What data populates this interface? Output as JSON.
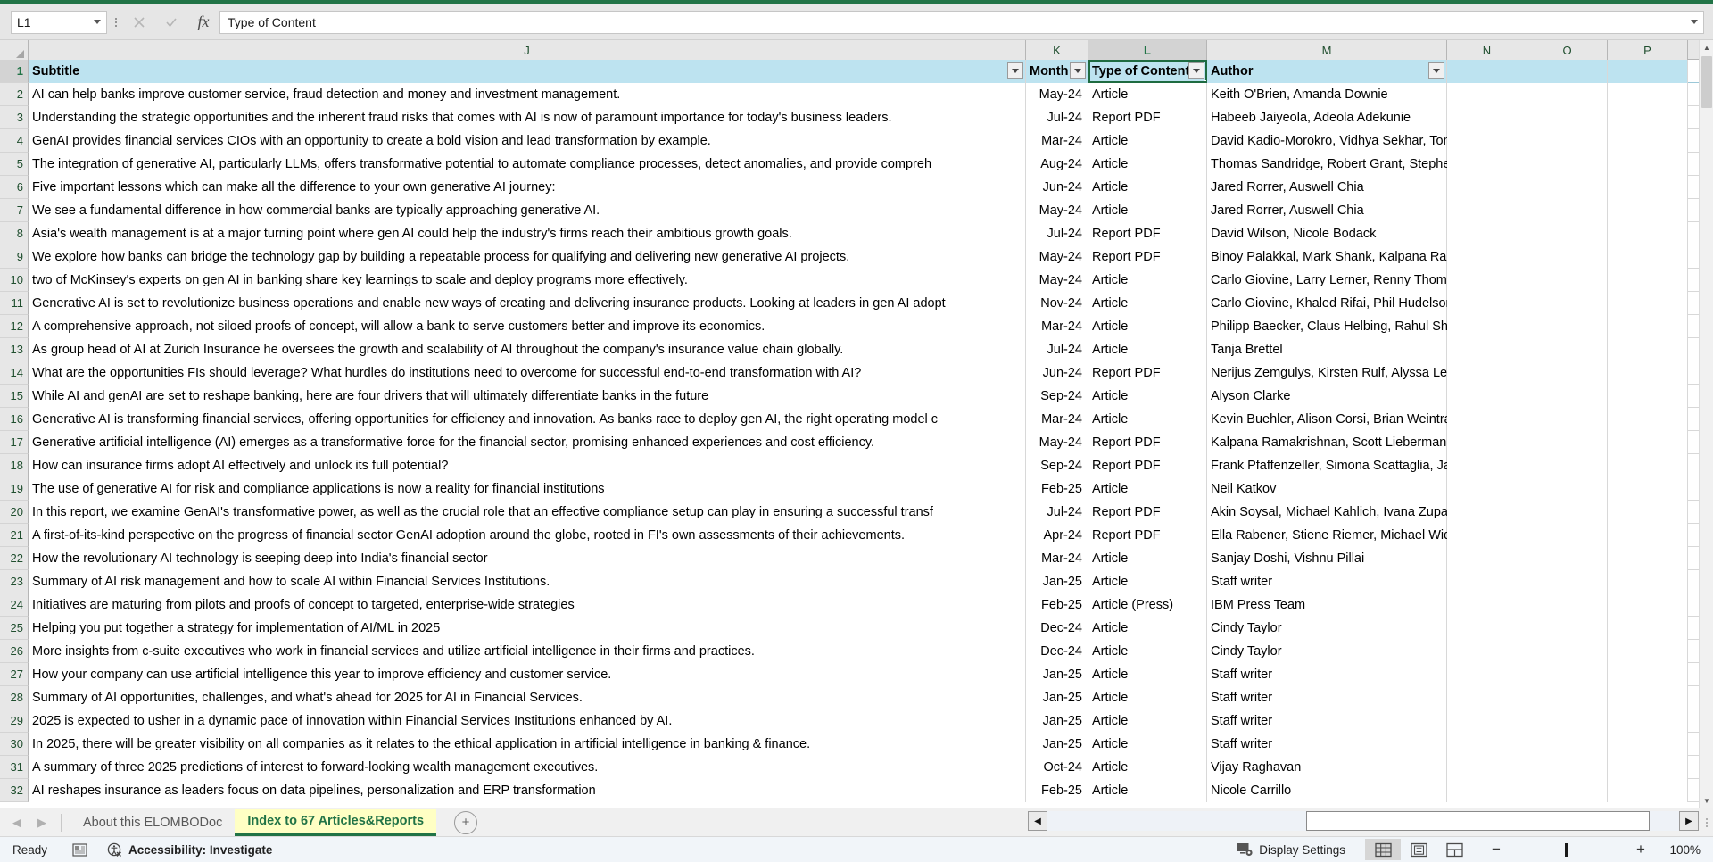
{
  "formula_bar": {
    "name_box_value": "L1",
    "cancel_icon": "close-icon",
    "confirm_icon": "check-icon",
    "function_icon": "fx-icon",
    "formula_value": "Type of Content"
  },
  "grid": {
    "column_headers": [
      "J",
      "K",
      "L",
      "M",
      "N",
      "O",
      "P"
    ],
    "selected_column": "L",
    "selected_cell": "L1",
    "header_row_index": "1",
    "headers": {
      "J": "Subtitle",
      "K": "Month P",
      "L": "Type of Content",
      "M": "Author",
      "N": "",
      "O": "",
      "P": ""
    },
    "rows": [
      {
        "n": "2",
        "subtitle": "AI can help banks improve customer service, fraud detection and money and investment management.",
        "month": "May-24",
        "type": "Article",
        "author": "Keith O'Brien, Amanda Downie"
      },
      {
        "n": "3",
        "subtitle": "Understanding the strategic opportunities and the inherent fraud risks that comes with AI is now of paramount importance for today's business leaders.",
        "month": "Jul-24",
        "type": "Report PDF",
        "author": "Habeeb Jaiyeola, Adeola Adekunie"
      },
      {
        "n": "4",
        "subtitle": "GenAI provides financial services CIOs with an opportunity to create a bold vision and lead transformation by example.",
        "month": "Mar-24",
        "type": "Article",
        "author": "David Kadio-Morokro, Vidhya Sekhar, Tommy Vater, Shobhan Dutta"
      },
      {
        "n": "5",
        "subtitle": "The integration of generative AI, particularly LLMs, offers transformative potential to automate compliance processes, detect anomalies, and provide compreh",
        "month": "Aug-24",
        "type": "Article",
        "author": "Thomas Sandridge, Robert Grant, Stephen Forster, Brandon Harris"
      },
      {
        "n": "6",
        "subtitle": "Five important lessons which can make all the difference to your own generative AI journey:",
        "month": "Jun-24",
        "type": "Article",
        "author": "Jared Rorrer, Auswell Chia"
      },
      {
        "n": "7",
        "subtitle": "We see a fundamental difference in how commercial banks are typically approaching generative AI.",
        "month": "May-24",
        "type": "Article",
        "author": "Jared Rorrer, Auswell Chia"
      },
      {
        "n": "8",
        "subtitle": "Asia's wealth management is at a major turning point where gen AI could help the industry's firms reach their ambitious growth goals.",
        "month": "Jul-24",
        "type": "Report PDF",
        "author": "David Wilson, Nicole Bodack"
      },
      {
        "n": "9",
        "subtitle": "We explore how banks can bridge the technology gap by building a repeatable process for qualifying and delivering new generative AI projects.",
        "month": "May-24",
        "type": "Report PDF",
        "author": "Binoy Palakkal, Mark Shank, Kalpana Ramakrishnan"
      },
      {
        "n": "10",
        "subtitle": "two of McKinsey's experts on gen AI in banking share key learnings to scale and deploy programs more effectively.",
        "month": "May-24",
        "type": "Article",
        "author": "Carlo Giovine, Larry Lerner, Renny Thomas, Shwaitang Singh, Sudhakar"
      },
      {
        "n": "11",
        "subtitle": "Generative AI is set to revolutionize business operations and enable new ways of creating and delivering insurance products. Looking at leaders in gen AI adopt",
        "month": "Nov-24",
        "type": "Article",
        "author": "Carlo Giovine, Khaled Rifai, Phil Hudelson, Priti Joseph, and Sid Kamath"
      },
      {
        "n": "12",
        "subtitle": "A comprehensive approach, not siloed proofs of concept, will allow a bank to serve customers better and improve its economics.",
        "month": "Mar-24",
        "type": "Article",
        "author": "Philipp Baecker, Claus Helbing, Rahul Shah, Geoffroy Descamps, and E"
      },
      {
        "n": "13",
        "subtitle": "As group head of AI at Zurich Insurance he oversees the growth and scalability of AI throughout the company's insurance value chain globally.",
        "month": "Jul-24",
        "type": "Article",
        "author": "Tanja Brettel"
      },
      {
        "n": "14",
        "subtitle": "What are the opportunities FIs should leverage? What hurdles do institutions need to overcome for successful end-to-end transformation with AI?",
        "month": "Jun-24",
        "type": "Report PDF",
        "author": "Nerijus Zemgulys,  Kirsten Rulf, Alyssa Lew, and Rafat Kapadia"
      },
      {
        "n": "15",
        "subtitle": "While AI and genAI are set to reshape banking, here are four drivers that will ultimately differentiate banks in the future",
        "month": "Sep-24",
        "type": "Article",
        "author": "Alyson Clarke"
      },
      {
        "n": "16",
        "subtitle": "Generative AI is transforming financial services, offering opportunities for efficiency and innovation. As banks race to deploy gen AI, the right operating model c",
        "month": "Mar-24",
        "type": "Article",
        "author": "Kevin Buehler, Alison Corsi, Brian Weintraub, Mina Jurisic, Andrea Sian"
      },
      {
        "n": "17",
        "subtitle": "Generative artificial intelligence (AI) emerges as a transformative force for the financial sector, promising enhanced experiences and cost efficiency.",
        "month": "May-24",
        "type": "Report PDF",
        "author": "Kalpana Ramakrishnan, Scott Lieberman, Manish Shah"
      },
      {
        "n": "18",
        "subtitle": "How can insurance firms adopt AI effectively and unlock its full potential?",
        "month": "Sep-24",
        "type": "Report PDF",
        "author": "Frank Pfaffenzeller, Simona Scattaglia, James Henderson"
      },
      {
        "n": "19",
        "subtitle": "The use of generative AI for risk and compliance applications is now a reality for financial institutions",
        "month": "Feb-25",
        "type": "Article",
        "author": "Neil Katkov"
      },
      {
        "n": "20",
        "subtitle": "In this report, we examine GenAI's transformative power, as well as the crucial role that an effective compliance setup can play in ensuring a successful transf",
        "month": "Jul-24",
        "type": "Report PDF",
        "author": "Akin Soysal,  Michael Kahlich,  Ivana Zupa,  Dean Frankle,  Peter Czerep"
      },
      {
        "n": "21",
        "subtitle": "A first-of-its-kind perspective on the progress of financial sector GenAI adoption around the globe, rooted in FI's own assessments of their achievements.",
        "month": "Apr-24",
        "type": "Report PDF",
        "author": "Ella Rabener, Stiene Riemer, Michael Widowitz, Michael Strauss, and C"
      },
      {
        "n": "22",
        "subtitle": "How the revolutionary AI technology is seeping deep into India's financial sector",
        "month": "Mar-24",
        "type": "Article",
        "author": "Sanjay Doshi, Vishnu Pillai"
      },
      {
        "n": "23",
        "subtitle": "Summary of AI risk management and how to scale AI within Financial Services Institutions.",
        "month": "Jan-25",
        "type": "Article",
        "author": "Staff writer"
      },
      {
        "n": "24",
        "subtitle": "Initiatives are maturing from pilots and proofs of concept to targeted, enterprise-wide strategies",
        "month": "Feb-25",
        "type": "Article (Press)",
        "author": "IBM Press Team"
      },
      {
        "n": "25",
        "subtitle": "Helping you put together a strategy for implementation of AI/ML in 2025",
        "month": "Dec-24",
        "type": "Article",
        "author": "Cindy Taylor"
      },
      {
        "n": "26",
        "subtitle": "More insights from c-suite executives who work in financial services and utilize artificial intelligence in their firms and practices.",
        "month": "Dec-24",
        "type": "Article",
        "author": "Cindy Taylor"
      },
      {
        "n": "27",
        "subtitle": "How your company can use artificial intelligence this year to improve efficiency and customer service.",
        "month": "Jan-25",
        "type": "Article",
        "author": "Staff writer"
      },
      {
        "n": "28",
        "subtitle": "Summary of AI opportunities, challenges, and what's ahead for 2025 for AI in Financial Services.",
        "month": "Jan-25",
        "type": "Article",
        "author": "Staff writer"
      },
      {
        "n": "29",
        "subtitle": "2025 is expected to usher in a dynamic pace of innovation within Financial Services Institutions enhanced by AI.",
        "month": "Jan-25",
        "type": "Article",
        "author": "Staff writer"
      },
      {
        "n": "30",
        "subtitle": "In 2025, there will be greater visibility on all companies as it relates to the ethical application in artificial intelligence in banking & finance.",
        "month": "Jan-25",
        "type": "Article",
        "author": "Staff writer"
      },
      {
        "n": "31",
        "subtitle": "A summary of three 2025 predictions of interest to forward-looking wealth management executives.",
        "month": "Oct-24",
        "type": "Article",
        "author": "Vijay Raghavan"
      },
      {
        "n": "32",
        "subtitle": "AI reshapes insurance as leaders focus on data pipelines, personalization and ERP transformation",
        "month": "Feb-25",
        "type": "Article",
        "author": "Nicole Carrillo"
      }
    ]
  },
  "sheet_tabs": {
    "prev_icon": "left-arrow-icon",
    "next_icon": "right-arrow-icon",
    "tabs": [
      {
        "label": "About this ELOMBODoc",
        "active": false
      },
      {
        "label": "Index to 67 Articles&Reports",
        "active": true
      }
    ],
    "add_sheet_icon": "plus-circle-icon"
  },
  "status_bar": {
    "mode": "Ready",
    "macro_icon": "record-macro-icon",
    "accessibility_icon": "accessibility-icon",
    "accessibility_text": "Accessibility: Investigate",
    "display_settings_icon": "display-settings-icon",
    "display_settings_label": "Display Settings",
    "views": [
      {
        "name": "normal-view",
        "active": true
      },
      {
        "name": "page-layout-view",
        "active": false
      },
      {
        "name": "page-break-preview",
        "active": false
      }
    ],
    "zoom_out_label": "−",
    "zoom_in_label": "+",
    "zoom_level": "100%"
  },
  "colors": {
    "brand_green": "#217346",
    "header_fill": "#bde3f0",
    "active_tab_fill": "#ffffc4"
  }
}
